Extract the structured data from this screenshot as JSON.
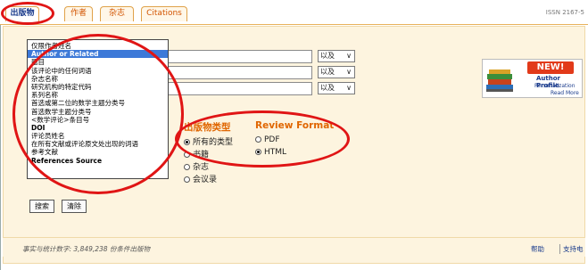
{
  "tabs": [
    {
      "label": "出版物",
      "active": true
    },
    {
      "label": "作者",
      "active": false
    },
    {
      "label": "杂志",
      "active": false
    },
    {
      "label": "Citations",
      "active": false
    }
  ],
  "issn": "ISSN 2167-5",
  "search_rows": [
    {
      "operator": "以及"
    },
    {
      "operator": "以及"
    },
    {
      "operator": "以及"
    }
  ],
  "field_list": {
    "items": [
      {
        "label": "仅限作者姓名",
        "selected": false,
        "bold": false
      },
      {
        "label": "Author or Related",
        "selected": true,
        "bold": true
      },
      {
        "label": "题目",
        "selected": false,
        "bold": false
      },
      {
        "label": "该评论中的任何词语",
        "selected": false,
        "bold": false
      },
      {
        "label": "杂志名称",
        "selected": false,
        "bold": false
      },
      {
        "label": "研究机构的特定代码",
        "selected": false,
        "bold": false
      },
      {
        "label": "系列名称",
        "selected": false,
        "bold": false
      },
      {
        "label": "首选或第二位的数学主题分类号",
        "selected": false,
        "bold": false
      },
      {
        "label": "首选数学主题分类号",
        "selected": false,
        "bold": false
      },
      {
        "label": "<数学评论>条目号",
        "selected": false,
        "bold": false
      },
      {
        "label": "DOI",
        "selected": false,
        "bold": true
      },
      {
        "label": "评论员姓名",
        "selected": false,
        "bold": false
      },
      {
        "label": "在所有文献或评论原文处出现的词语",
        "selected": false,
        "bold": false
      },
      {
        "label": "参考文献",
        "selected": false,
        "bold": false
      },
      {
        "label": "References Source",
        "selected": false,
        "bold": true
      }
    ]
  },
  "pub_type": {
    "heading": "出版物类型",
    "options": [
      {
        "label": "所有的类型",
        "checked": true
      },
      {
        "label": "书籍",
        "checked": false
      },
      {
        "label": "杂志",
        "checked": false
      },
      {
        "label": "会议录",
        "checked": false
      }
    ]
  },
  "review_format": {
    "heading": "Review Format",
    "options": [
      {
        "label": "PDF",
        "checked": false
      },
      {
        "label": "HTML",
        "checked": true
      }
    ]
  },
  "buttons": {
    "search": "搜索",
    "clear": "清除"
  },
  "footer": {
    "count_text": "事实与统计数字: 3,849,238 份条件出版物",
    "help": "帮助",
    "support": "支持电"
  },
  "promo": {
    "new": "NEW!",
    "line1": "Author Profile",
    "line2": "Personalization",
    "line3": "Read More"
  },
  "colors": {
    "accent_orange": "#e06600",
    "panel_bg": "#fdf4df",
    "selected_blue": "#3d79d8",
    "annotation_red": "#e01515"
  }
}
